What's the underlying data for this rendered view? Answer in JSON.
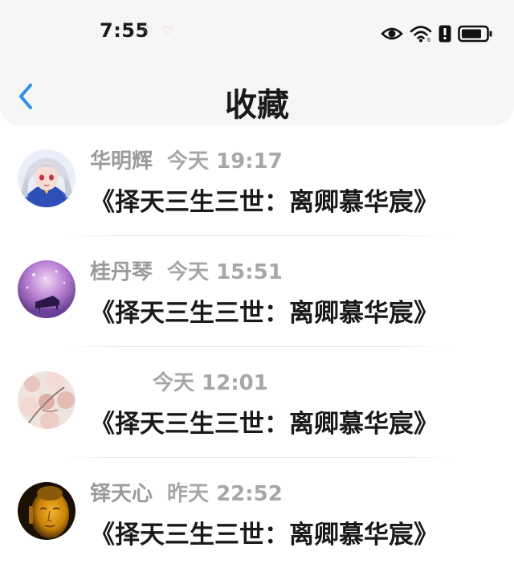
{
  "status_bar": {
    "time": "7:55",
    "hearts": "♡ ♡",
    "icons": [
      "eye-icon",
      "wifi-icon",
      "alert-icon",
      "battery-icon"
    ]
  },
  "header": {
    "back_icon": "chevron-left-icon",
    "title": "收藏"
  },
  "favorites": [
    {
      "name": "华明辉",
      "time": "今天 19:17",
      "content": "《择天三生三世：离卿慕华宸》",
      "avatar": "anime-girl-avatar"
    },
    {
      "name": "桂丹琴",
      "time": "今天 15:51",
      "content": "《择天三生三世：离卿慕华宸》",
      "avatar": "purple-piano-avatar"
    },
    {
      "name": "",
      "time": "今天 12:01",
      "content": "《择天三生三世：离卿慕华宸》",
      "avatar": "blossom-avatar"
    },
    {
      "name": "铎天心",
      "time": "昨天 22:52",
      "content": "《择天三生三世：离卿慕华宸》",
      "avatar": "golden-buddha-avatar"
    }
  ],
  "colors": {
    "accent": "#2b8fe8",
    "header_bg": "#f6f6f7",
    "meta_text": "#9b9b9b",
    "content_text": "#1a1a1a"
  }
}
